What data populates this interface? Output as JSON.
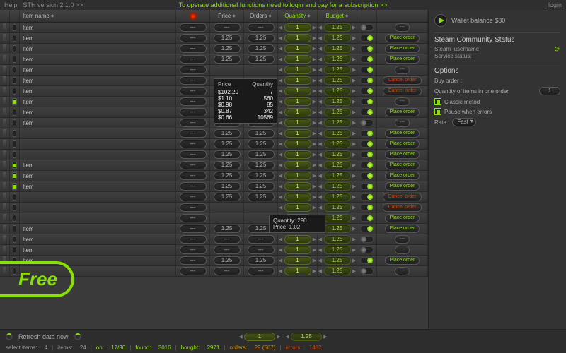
{
  "topbar": {
    "help": "Help",
    "version": "STH version 2.1.0 >>",
    "subscribe": "To operate additional functions need to login and pay for a subscription >>",
    "login": "login"
  },
  "columns": {
    "name": "Item name",
    "empty": "---",
    "price": "Price",
    "orders": "Orders",
    "quantity": "Quantity",
    "budget": "Budget"
  },
  "actions": {
    "place": "Place order",
    "cancel": "Cancel order",
    "dash": "---"
  },
  "rows": [
    {
      "chk": false,
      "name": "Item",
      "price": "---",
      "orders": "---",
      "qty": "1",
      "budget": "1.25",
      "tg": "off",
      "act": "dash"
    },
    {
      "chk": false,
      "name": "Item",
      "price": "1.25",
      "orders": "1.25",
      "qty": "1",
      "budget": "1.25",
      "tg": "on",
      "act": "place"
    },
    {
      "chk": false,
      "name": "Item",
      "price": "1.25",
      "orders": "1.25",
      "qty": "1",
      "budget": "1.25",
      "tg": "on",
      "act": "place"
    },
    {
      "chk": false,
      "name": "Item",
      "price": "1.25",
      "orders": "1.25",
      "qty": "1",
      "budget": "1.25",
      "tg": "on",
      "act": "place"
    },
    {
      "chk": false,
      "name": "Item",
      "price": "",
      "orders": "",
      "qty": "1",
      "budget": "1.25",
      "tg": "on",
      "act": "dash"
    },
    {
      "chk": false,
      "name": "Item",
      "price": "",
      "orders": "",
      "qty": "1",
      "budget": "1.25",
      "tg": "on",
      "act": "cancel"
    },
    {
      "chk": false,
      "name": "Item",
      "price": "",
      "orders": "",
      "qty": "1",
      "budget": "1.25",
      "tg": "on",
      "act": "cancel"
    },
    {
      "chk": true,
      "name": "Item",
      "price": "",
      "orders": "",
      "qty": "1",
      "budget": "1.25",
      "tg": "on",
      "act": "dash"
    },
    {
      "chk": false,
      "name": "Item",
      "price": "1.25",
      "orders": "1.25",
      "qty": "1",
      "budget": "1.25",
      "tg": "on",
      "act": "place"
    },
    {
      "chk": false,
      "name": "Item",
      "price": "---",
      "orders": "---",
      "qty": "1",
      "budget": "1.25",
      "tg": "off",
      "act": "dash"
    },
    {
      "chk": false,
      "name": "",
      "price": "1.25",
      "orders": "1.25",
      "qty": "1",
      "budget": "1.25",
      "tg": "on",
      "act": "place"
    },
    {
      "chk": false,
      "name": "",
      "price": "1.25",
      "orders": "1.25",
      "qty": "1",
      "budget": "1.25",
      "tg": "on",
      "act": "place"
    },
    {
      "chk": false,
      "name": "",
      "price": "1.25",
      "orders": "1.25",
      "qty": "1",
      "budget": "1.25",
      "tg": "on",
      "act": "place"
    },
    {
      "chk": true,
      "name": "Item",
      "price": "1.25",
      "orders": "1.25",
      "qty": "1",
      "budget": "1.25",
      "tg": "on",
      "act": "place"
    },
    {
      "chk": true,
      "name": "Item",
      "price": "1.25",
      "orders": "1.25",
      "qty": "1",
      "budget": "1.25",
      "tg": "on",
      "act": "place"
    },
    {
      "chk": true,
      "name": "Item",
      "price": "1.25",
      "orders": "1.25",
      "qty": "1",
      "budget": "1.25",
      "tg": "on",
      "act": "place"
    },
    {
      "chk": false,
      "name": "",
      "price": "1.25",
      "orders": "1.25",
      "qty": "1",
      "budget": "1.25",
      "tg": "on",
      "act": "cancel"
    },
    {
      "chk": false,
      "name": "",
      "price": "",
      "orders": "",
      "qty": "1",
      "budget": "1.25",
      "tg": "on",
      "act": "cancel"
    },
    {
      "chk": false,
      "name": "",
      "price": "",
      "orders": "",
      "qty": "1",
      "budget": "1.25",
      "tg": "on",
      "act": "place"
    },
    {
      "chk": false,
      "name": "Item",
      "price": "1.25",
      "orders": "1.25",
      "qty": "1",
      "budget": "1.25",
      "tg": "on",
      "act": "place"
    },
    {
      "chk": false,
      "name": "Item",
      "price": "---",
      "orders": "---",
      "qty": "1",
      "budget": "1.25",
      "tg": "off",
      "act": "dash"
    },
    {
      "chk": false,
      "name": "Item",
      "price": "---",
      "orders": "---",
      "qty": "1",
      "budget": "1.25",
      "tg": "off",
      "act": "dash"
    },
    {
      "chk": false,
      "name": "Item",
      "price": "1.25",
      "orders": "1.25",
      "qty": "1",
      "budget": "1.25",
      "tg": "on",
      "act": "place"
    },
    {
      "chk": false,
      "name": "",
      "price": "---",
      "orders": "---",
      "qty": "1",
      "budget": "1.25",
      "tg": "off",
      "act": "dash"
    }
  ],
  "tooltip1": {
    "h1": "Price",
    "h2": "Quantity",
    "rows": [
      [
        "$102.20",
        "7"
      ],
      [
        "$1.10",
        "560"
      ],
      [
        "$0.98",
        "85"
      ],
      [
        "$0.87",
        "342"
      ],
      [
        "$0.66",
        "10569"
      ]
    ]
  },
  "tooltip2": {
    "l1": "Quantity: 290",
    "l2": "Price:   1.02"
  },
  "side": {
    "wallet": "Wallet balance $80",
    "status_h": "Steam Community Status",
    "steam_user": "Steam_username",
    "service": "Service status:",
    "options_h": "Options",
    "buy_order": "Buy order :",
    "qty_label": "Quantity of items in one order",
    "qty_val": "1",
    "classic": "Classic metod",
    "pause": "Pause when errors",
    "rate_l": "Rate :",
    "rate_v": "Fast"
  },
  "free": "Free",
  "footer": {
    "refresh": "Refresh data now",
    "qty": "1",
    "budget": "1.25",
    "stats": {
      "select_l": "select items:",
      "select_v": "4",
      "items_l": "items:",
      "items_v": "24",
      "on_l": "on:",
      "on_v": "17/30",
      "found_l": "found:",
      "found_v": "3016",
      "bought_l": "bought:",
      "bought_v": "2971",
      "orders_l": "orders:",
      "orders_v": "29 (567)",
      "errors_l": "errors:",
      "errors_v": "1487"
    }
  }
}
